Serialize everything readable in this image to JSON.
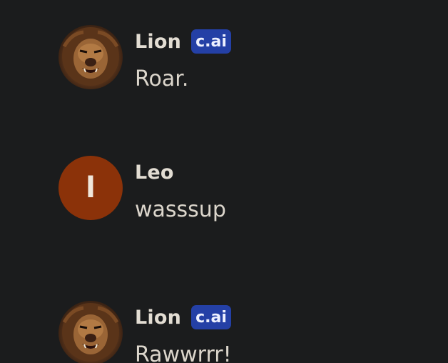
{
  "messages": [
    {
      "sender": "Lion",
      "badge": "c.ai",
      "avatar": "lion-photo",
      "text": "Roar."
    },
    {
      "sender": "Leo",
      "avatar_letter": "l",
      "avatar_color": "#8b3209",
      "text": "wasssup"
    },
    {
      "sender": "Lion",
      "badge": "c.ai",
      "avatar": "lion-photo",
      "text": "Rawwrrr!"
    }
  ],
  "colors": {
    "background": "#1b1c1d",
    "badge": "#2440a6",
    "name_text": "#e3ddd3",
    "message_text": "#dcd6cc"
  }
}
